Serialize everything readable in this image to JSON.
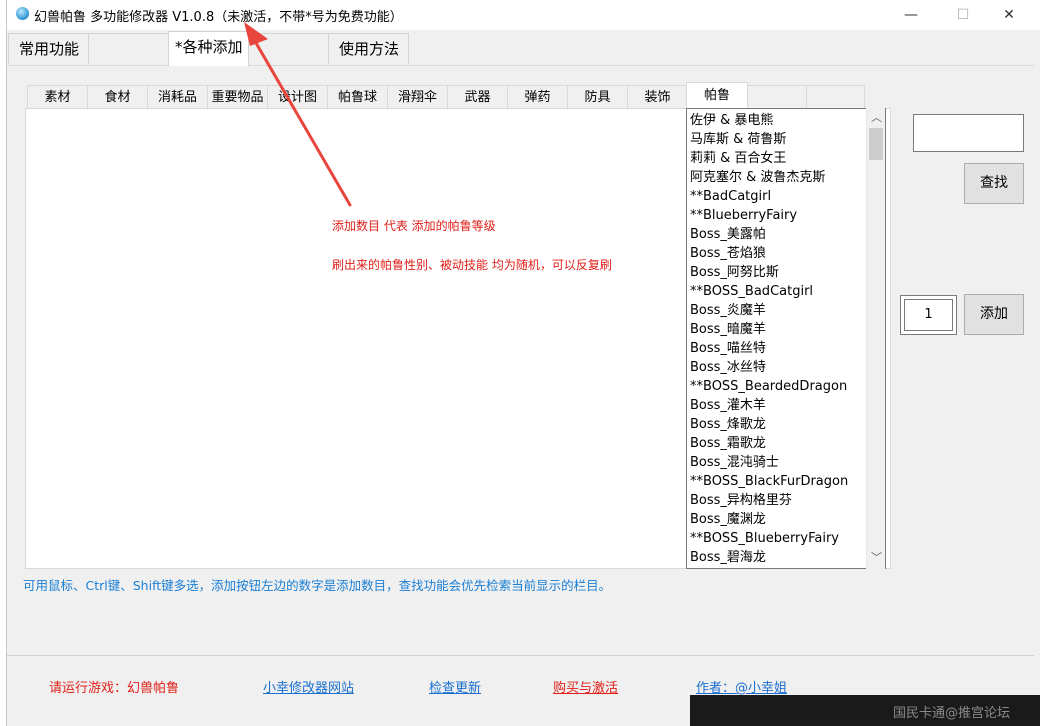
{
  "window": {
    "title": "幻兽帕鲁 多功能修改器  V1.0.8（未激活，不带*号为免费功能）",
    "minimize": "—",
    "maximize": "☐",
    "close": "✕"
  },
  "main_tabs": [
    {
      "label": "常用功能"
    },
    {
      "label": ""
    },
    {
      "label": "*各种添加"
    },
    {
      "label": ""
    },
    {
      "label": "使用方法"
    }
  ],
  "sub_tabs": [
    {
      "label": "素材"
    },
    {
      "label": "食材"
    },
    {
      "label": "消耗品"
    },
    {
      "label": "重要物品"
    },
    {
      "label": "设计图"
    },
    {
      "label": "帕鲁球"
    },
    {
      "label": "滑翔伞"
    },
    {
      "label": "武器"
    },
    {
      "label": "弹药"
    },
    {
      "label": "防具"
    },
    {
      "label": "装饰"
    },
    {
      "label": "帕鲁"
    },
    {
      "label": ""
    }
  ],
  "list_items": [
    "佐伊 & 暴电熊",
    "马库斯 & 荷鲁斯",
    "莉莉 & 百合女王",
    "阿克塞尔 & 波鲁杰克斯",
    "**BadCatgirl",
    "**BlueberryFairy",
    "Boss_美露帕",
    "Boss_苍焰狼",
    "Boss_阿努比斯",
    "**BOSS_BadCatgirl",
    "Boss_炎魔羊",
    "Boss_暗魔羊",
    "Boss_喵丝特",
    "Boss_冰丝特",
    "**BOSS_BeardedDragon",
    "Boss_灌木羊",
    "Boss_烽歌龙",
    "Boss_霜歌龙",
    "Boss_混沌骑士",
    "**BOSS_BlackFurDragon",
    "Boss_异构格里芬",
    "Boss_魔渊龙",
    "**BOSS_BlueberryFairy",
    "Boss_碧海龙"
  ],
  "controls": {
    "search_value": "",
    "search_button": "查找",
    "quantity_value": "1",
    "add_button": "添加"
  },
  "annotations": {
    "note1": "添加数目 代表 添加的帕鲁等级",
    "note2": "刷出来的帕鲁性别、被动技能 均为随机，可以反复刷",
    "arrow_color": "#e8453c"
  },
  "hint": "可用鼠标、Ctrl键、Shift键多选，添加按钮左边的数字是添加数目，查找功能会优先检索当前显示的栏目。",
  "footer": {
    "run_game": "请运行游戏：幻兽帕鲁",
    "website": "小幸修改器网站",
    "check_update": "检查更新",
    "buy_activate": "购买与激活",
    "author": "作者：@小幸姐"
  },
  "watermark": "国民卡通@推宫论坛"
}
